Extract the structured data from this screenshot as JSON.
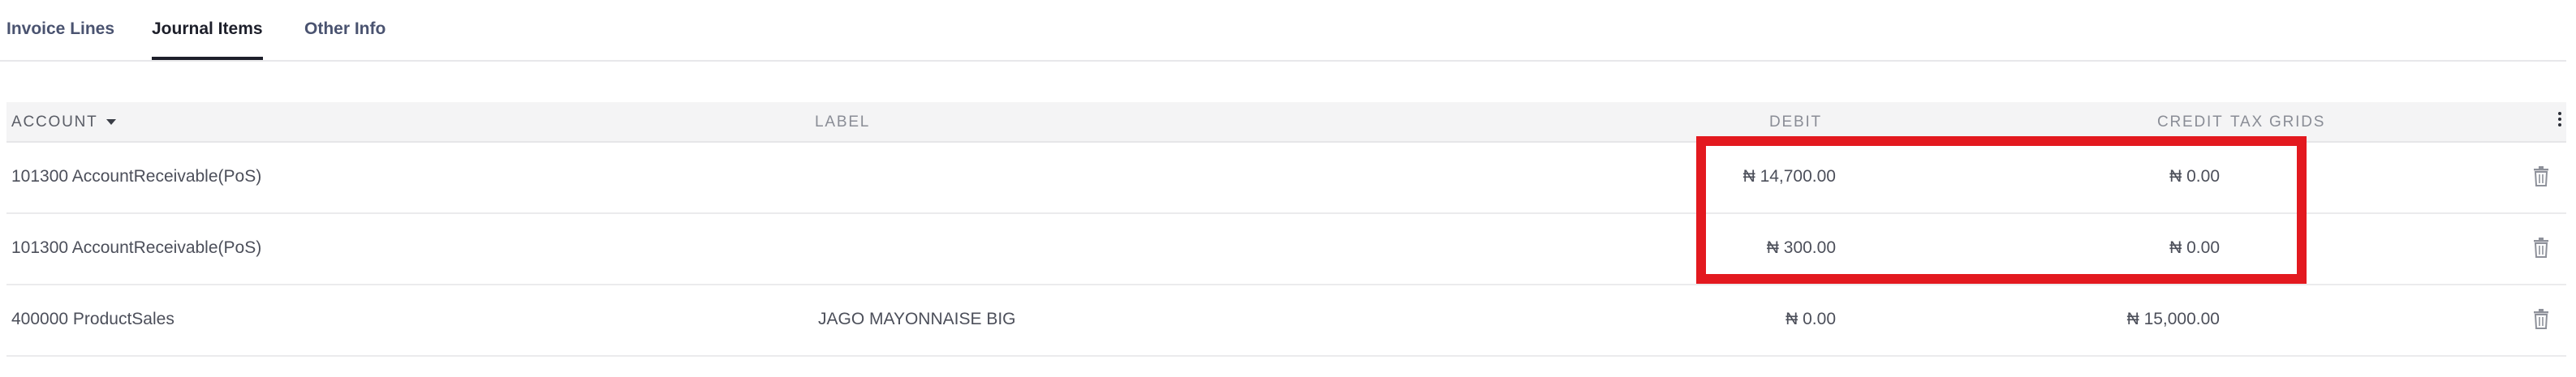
{
  "tabs": [
    {
      "label": "Invoice Lines",
      "active": false
    },
    {
      "label": "Journal Items",
      "active": true
    },
    {
      "label": "Other Info",
      "active": false
    }
  ],
  "table": {
    "headers": {
      "account": "ACCOUNT",
      "label": "LABEL",
      "debit": "DEBIT",
      "credit": "CREDIT",
      "tax_grids": "TAX GRIDS"
    },
    "rows": [
      {
        "account": "101300 AccountReceivable(PoS)",
        "label": "",
        "debit": "₦ 14,700.00",
        "credit": "₦ 0.00"
      },
      {
        "account": "101300 AccountReceivable(PoS)",
        "label": "",
        "debit": "₦ 300.00",
        "credit": "₦ 0.00"
      },
      {
        "account": "400000 ProductSales",
        "label": "JAGO MAYONNAISE BIG",
        "debit": "₦ 0.00",
        "credit": "₦ 15,000.00"
      }
    ]
  },
  "icons": {
    "column_options": "kebab-menu-icon",
    "sort": "caret-down-icon",
    "delete": "trash-icon"
  },
  "colors": {
    "annotation": "#e3191f",
    "active_tab_underline": "#1d1f2a",
    "tab_text": "#4a5370",
    "header_bg": "#f4f4f5"
  }
}
